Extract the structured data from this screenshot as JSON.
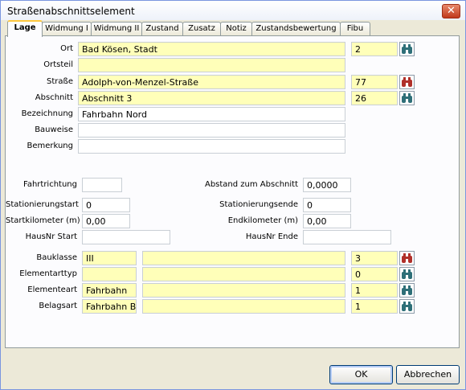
{
  "window": {
    "title": "Straßenabschnittselement",
    "close_symbol": "✕"
  },
  "tabs": [
    {
      "label": "Lage"
    },
    {
      "label": "Widmung I"
    },
    {
      "label": "Widmung II"
    },
    {
      "label": "Zustand"
    },
    {
      "label": "Zusatz"
    },
    {
      "label": "Notiz"
    },
    {
      "label": "Zustandsbewertung"
    },
    {
      "label": "Fibu"
    }
  ],
  "active_tab": "Lage",
  "location": {
    "ort": {
      "label": "Ort",
      "value": "Bad Kösen, Stadt",
      "code": "2"
    },
    "ortsteil": {
      "label": "Ortsteil",
      "value": ""
    },
    "strasse": {
      "label": "Straße",
      "value": "Adolph-von-Menzel-Straße",
      "code": "77"
    },
    "abschnitt": {
      "label": "Abschnitt",
      "value": "Abschnitt 3",
      "code": "26"
    },
    "bezeichnung": {
      "label": "Bezeichnung",
      "value": "Fahrbahn Nord"
    },
    "bauweise": {
      "label": "Bauweise",
      "value": ""
    },
    "bemerkung": {
      "label": "Bemerkung",
      "value": ""
    }
  },
  "geometry": {
    "fahrtrichtung": {
      "label": "Fahrtrichtung",
      "value": ""
    },
    "abstand": {
      "label": "Abstand zum Abschnitt",
      "value": "0,0000"
    },
    "stationierungstart": {
      "label": "Stationierungstart",
      "value": "0"
    },
    "stationierungsende": {
      "label": "Stationierungsende",
      "value": "0"
    },
    "startkilometer": {
      "label": "Startkilometer (m)",
      "value": "0,00"
    },
    "endkilometer": {
      "label": "Endkilometer (m)",
      "value": "0,00"
    },
    "hausnr_start": {
      "label": "HausNr Start",
      "value": ""
    },
    "hausnr_ende": {
      "label": "HausNr Ende",
      "value": ""
    }
  },
  "classification": {
    "bauklasse": {
      "label": "Bauklasse",
      "value": "III",
      "text": "",
      "code": "3"
    },
    "elementarttyp": {
      "label": "Elementarttyp",
      "value": "",
      "text": "",
      "code": "0"
    },
    "elementeart": {
      "label": "Elementeart",
      "value": "Fahrbahn",
      "text": "",
      "code": "1"
    },
    "belagsart": {
      "label": "Belagsart",
      "value": "Fahrbahn Bet",
      "text": "",
      "code": "1"
    }
  },
  "buttons": {
    "ok": "OK",
    "cancel": "Abbrechen"
  },
  "colors": {
    "required_field": "#ffffb9",
    "tab_highlight": "#ffc83c",
    "title_close": "#c0391b",
    "binoculars": "#2e6f78",
    "binoculars_red": "#b0302a"
  }
}
